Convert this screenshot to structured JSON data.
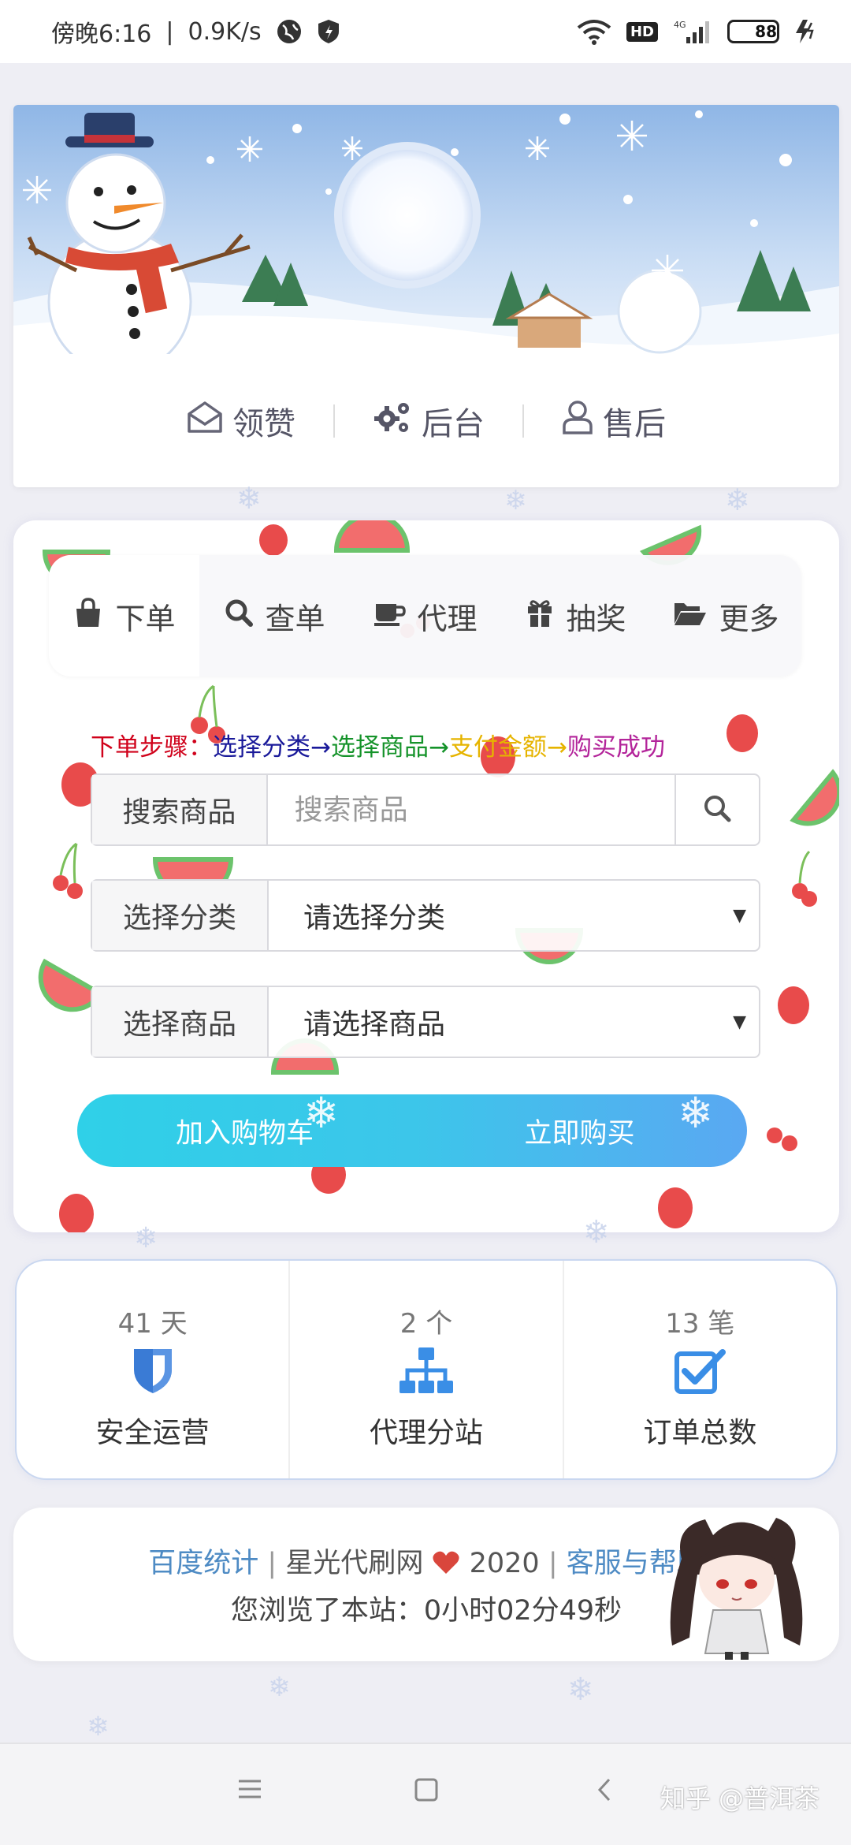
{
  "status_bar": {
    "carrier": "傍晚6:16",
    "speed": "0.9K/s",
    "hd": "HD",
    "network": "4G",
    "battery": "88",
    "battery_level": 0.88
  },
  "banner_nav": [
    {
      "label": "领赞",
      "icon": "envelope-open-icon"
    },
    {
      "label": "后台",
      "icon": "gears-icon"
    },
    {
      "label": "售后",
      "icon": "user-icon"
    }
  ],
  "tabs": [
    {
      "label": "下单",
      "icon": "shopping-bag-icon"
    },
    {
      "label": "查单",
      "icon": "search-icon"
    },
    {
      "label": "代理",
      "icon": "coffee-cup-icon"
    },
    {
      "label": "抽奖",
      "icon": "gift-icon"
    },
    {
      "label": "更多",
      "icon": "folder-open-icon"
    }
  ],
  "steps": {
    "prefix": "下单步骤：",
    "s1": "选择分类→",
    "s2": "选择商品→",
    "s3": "支付金额→",
    "s4": "购买成功",
    "colors": {
      "prefix": "#d0021b",
      "s1": "#1a1a9a",
      "s2": "#15932a",
      "s3": "#e6b400",
      "s4": "#b3249a"
    }
  },
  "form": {
    "search": {
      "label": "搜索商品",
      "placeholder": "搜索商品"
    },
    "category": {
      "label": "选择分类",
      "value": "请选择分类"
    },
    "product": {
      "label": "选择商品",
      "value": "请选择商品"
    }
  },
  "buttons": {
    "add_cart": "加入购物车",
    "buy_now": "立即购买"
  },
  "stats": [
    {
      "num": "41 天",
      "label": "安全运营",
      "icon": "shield-icon",
      "color": "#3a7bd5"
    },
    {
      "num": "2 个",
      "label": "代理分站",
      "icon": "sitemap-icon",
      "color": "#3a8ee6"
    },
    {
      "num": "13 笔",
      "label": "订单总数",
      "icon": "checkbox-icon",
      "color": "#3a8ee6"
    }
  ],
  "footer": {
    "baidu": "百度统计",
    "sep": "|",
    "site": "星光代刷网",
    "year": "2020",
    "help": "客服与帮助",
    "browse": "您浏览了本站：0小时02分49秒"
  },
  "watermark": "知乎 @普洱茶"
}
